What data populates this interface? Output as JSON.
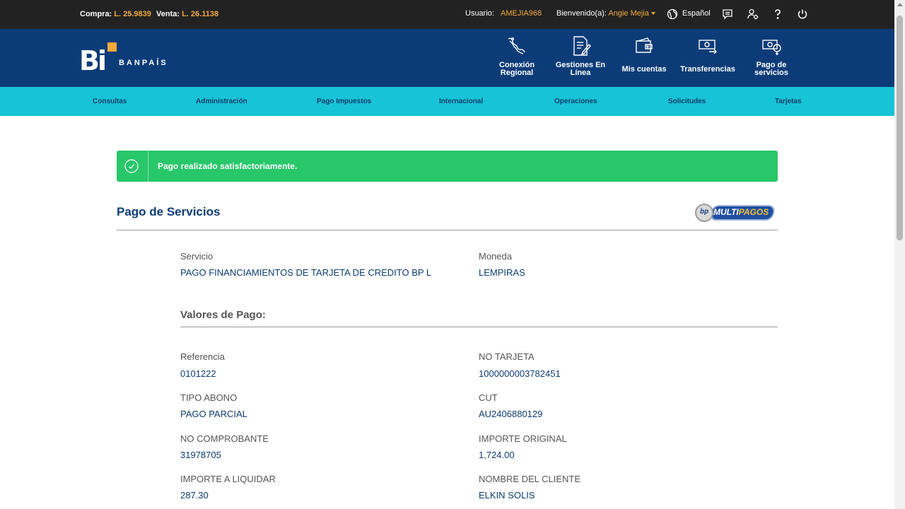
{
  "topbar": {
    "compra_label": "Compra:",
    "compra_value": "L. 25.9839",
    "venta_label": "Venta:",
    "venta_value": "L. 26.1138",
    "usuario_label": "Usuario:",
    "usuario_value": "AMEJIA968",
    "bienvenido_label": "Bienvenido(a):",
    "bienvenido_value": "Angie Mejia",
    "language": "Español",
    "icons": [
      "globe-icon",
      "message-icon",
      "user-settings-icon",
      "help-icon",
      "power-icon"
    ],
    "accent_color": "#f2a93b"
  },
  "header": {
    "brand": "BANPAÍS",
    "logo_text": "Bi",
    "nav": [
      {
        "label": "Conexión Regional",
        "icon": "map-icon"
      },
      {
        "label": "Gestiones En Línea",
        "icon": "document-edit-icon"
      },
      {
        "label": "Mis cuentas",
        "icon": "wallet-icon"
      },
      {
        "label": "Transferencias",
        "icon": "money-transfer-icon"
      },
      {
        "label": "Pago de servicios",
        "icon": "service-payment-icon"
      }
    ],
    "background": "#0c3c78"
  },
  "menu": {
    "items": [
      "Consultas",
      "Administración",
      "Pago Impuestos",
      "Internacional",
      "Operaciones",
      "Solicitudes",
      "Tarjetas"
    ],
    "background": "#17c3d6"
  },
  "alert": {
    "message": "Pago realizado satisfactoriamente.",
    "icon": "check-circle-icon",
    "color": "#28c76a"
  },
  "page": {
    "title": "Pago de Servicios",
    "provider_logo": "MULTIPAGOS",
    "servicio_label": "Servicio",
    "servicio_value": "PAGO FINANCIAMIENTOS DE TARJETA DE CREDITO BP L",
    "moneda_label": "Moneda",
    "moneda_value": "LEMPIRAS",
    "section_title": "Valores de Pago:",
    "fields": [
      {
        "label": "Referencia",
        "value": "0101222"
      },
      {
        "label": "NO TARJETA",
        "value": "1000000003782451"
      },
      {
        "label": "TIPO ABONO",
        "value": "PAGO PARCIAL"
      },
      {
        "label": "CUT",
        "value": "AU2406880129"
      },
      {
        "label": "NO COMPROBANTE",
        "value": "31978705"
      },
      {
        "label": "IMPORTE ORIGINAL",
        "value": "1,724.00"
      },
      {
        "label": "IMPORTE A LIQUIDAR",
        "value": "287.30"
      },
      {
        "label": "NOMBRE DEL CLIENTE",
        "value": "ELKIN SOLIS"
      }
    ]
  }
}
